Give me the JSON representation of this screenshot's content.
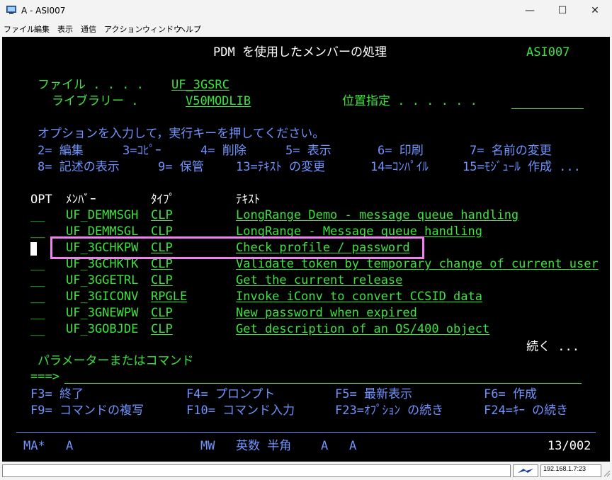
{
  "window": {
    "title": "A - ASI007",
    "min_icon": "—",
    "max_icon": "☐",
    "close_icon": "✕"
  },
  "menu": [
    "ファイル",
    "編集",
    "表示",
    "通信",
    "アクション",
    "ウィンドウ",
    "ヘルプ"
  ],
  "screen": {
    "header": "PDM を使用したメンバーの処理",
    "system": "ASI007",
    "file_label": "ファイル . . . .",
    "file_value": "UF_3GSRC",
    "library_label": "ライブラリー .",
    "library_value": "V50MODLIB",
    "position_label": "位置指定 . . . . . .",
    "instructions": "オプションを入力して，実行キーを押してください。",
    "options_row1": [
      "2= 編集",
      "3=ｺﾋﾟｰ",
      "4= 削除",
      "5= 表示",
      "6= 印刷",
      "7= 名前の変更"
    ],
    "options_row2": [
      "8= 記述の表示",
      "9= 保管",
      "13=ﾃｷｽﾄ の変更",
      "14=ｺﾝﾊﾟｲﾙ",
      "15=ﾓｼﾞｭｰﾙ 作成 ..."
    ],
    "columns": {
      "opt": "OPT",
      "member": "ﾒﾝﾊﾞｰ",
      "type": "ﾀｲﾌﾟ",
      "text": "ﾃｷｽﾄ"
    },
    "rows": [
      {
        "opt": "__",
        "member": "UF_DEMMSGH",
        "type": "CLP",
        "text": "LongRange Demo - message queue handling"
      },
      {
        "opt": "__",
        "member": "UF_DEMMSGL",
        "type": "CLP",
        "text": "LongRange - Message queue handling"
      },
      {
        "opt": "",
        "member": "UF_3GCHKPW",
        "type": "CLP",
        "text": "Check profile / password"
      },
      {
        "opt": "__",
        "member": "UF_3GCHKTK",
        "type": "CLP",
        "text": "Validate token by temporary change of current user"
      },
      {
        "opt": "__",
        "member": "UF_3GGETRL",
        "type": "CLP",
        "text": "Get the current release"
      },
      {
        "opt": "__",
        "member": "UF_3GICONV",
        "type": "RPGLE",
        "text": "Invoke iConv to convert CCSID data"
      },
      {
        "opt": "__",
        "member": "UF_3GNEWPW",
        "type": "CLP",
        "text": "New password when expired"
      },
      {
        "opt": "__",
        "member": "UF_3GOBJDE",
        "type": "CLP",
        "text": "Get description of an OS/400 object"
      }
    ],
    "more": "続く ...",
    "param_label": "パラメーターまたはコマンド",
    "prompt": "===>",
    "fkeys_row1": [
      "F3= 終了",
      "F4= プロンプト",
      "F5= 最新表示",
      "F6= 作成"
    ],
    "fkeys_row2": [
      "F9= コマンドの複写",
      "F10= コマンド入力",
      "F23=ｵﾌﾟｼｮﾝ の続き",
      "F24=ｷｰ の続き"
    ]
  },
  "oia": {
    "status": "MA*",
    "session": "A",
    "mw": "MW",
    "mode": "英数 半角",
    "s1": "A",
    "s2": "A",
    "cursor": "13/002"
  },
  "statusbar": {
    "address": "192.168.1.7:23"
  }
}
